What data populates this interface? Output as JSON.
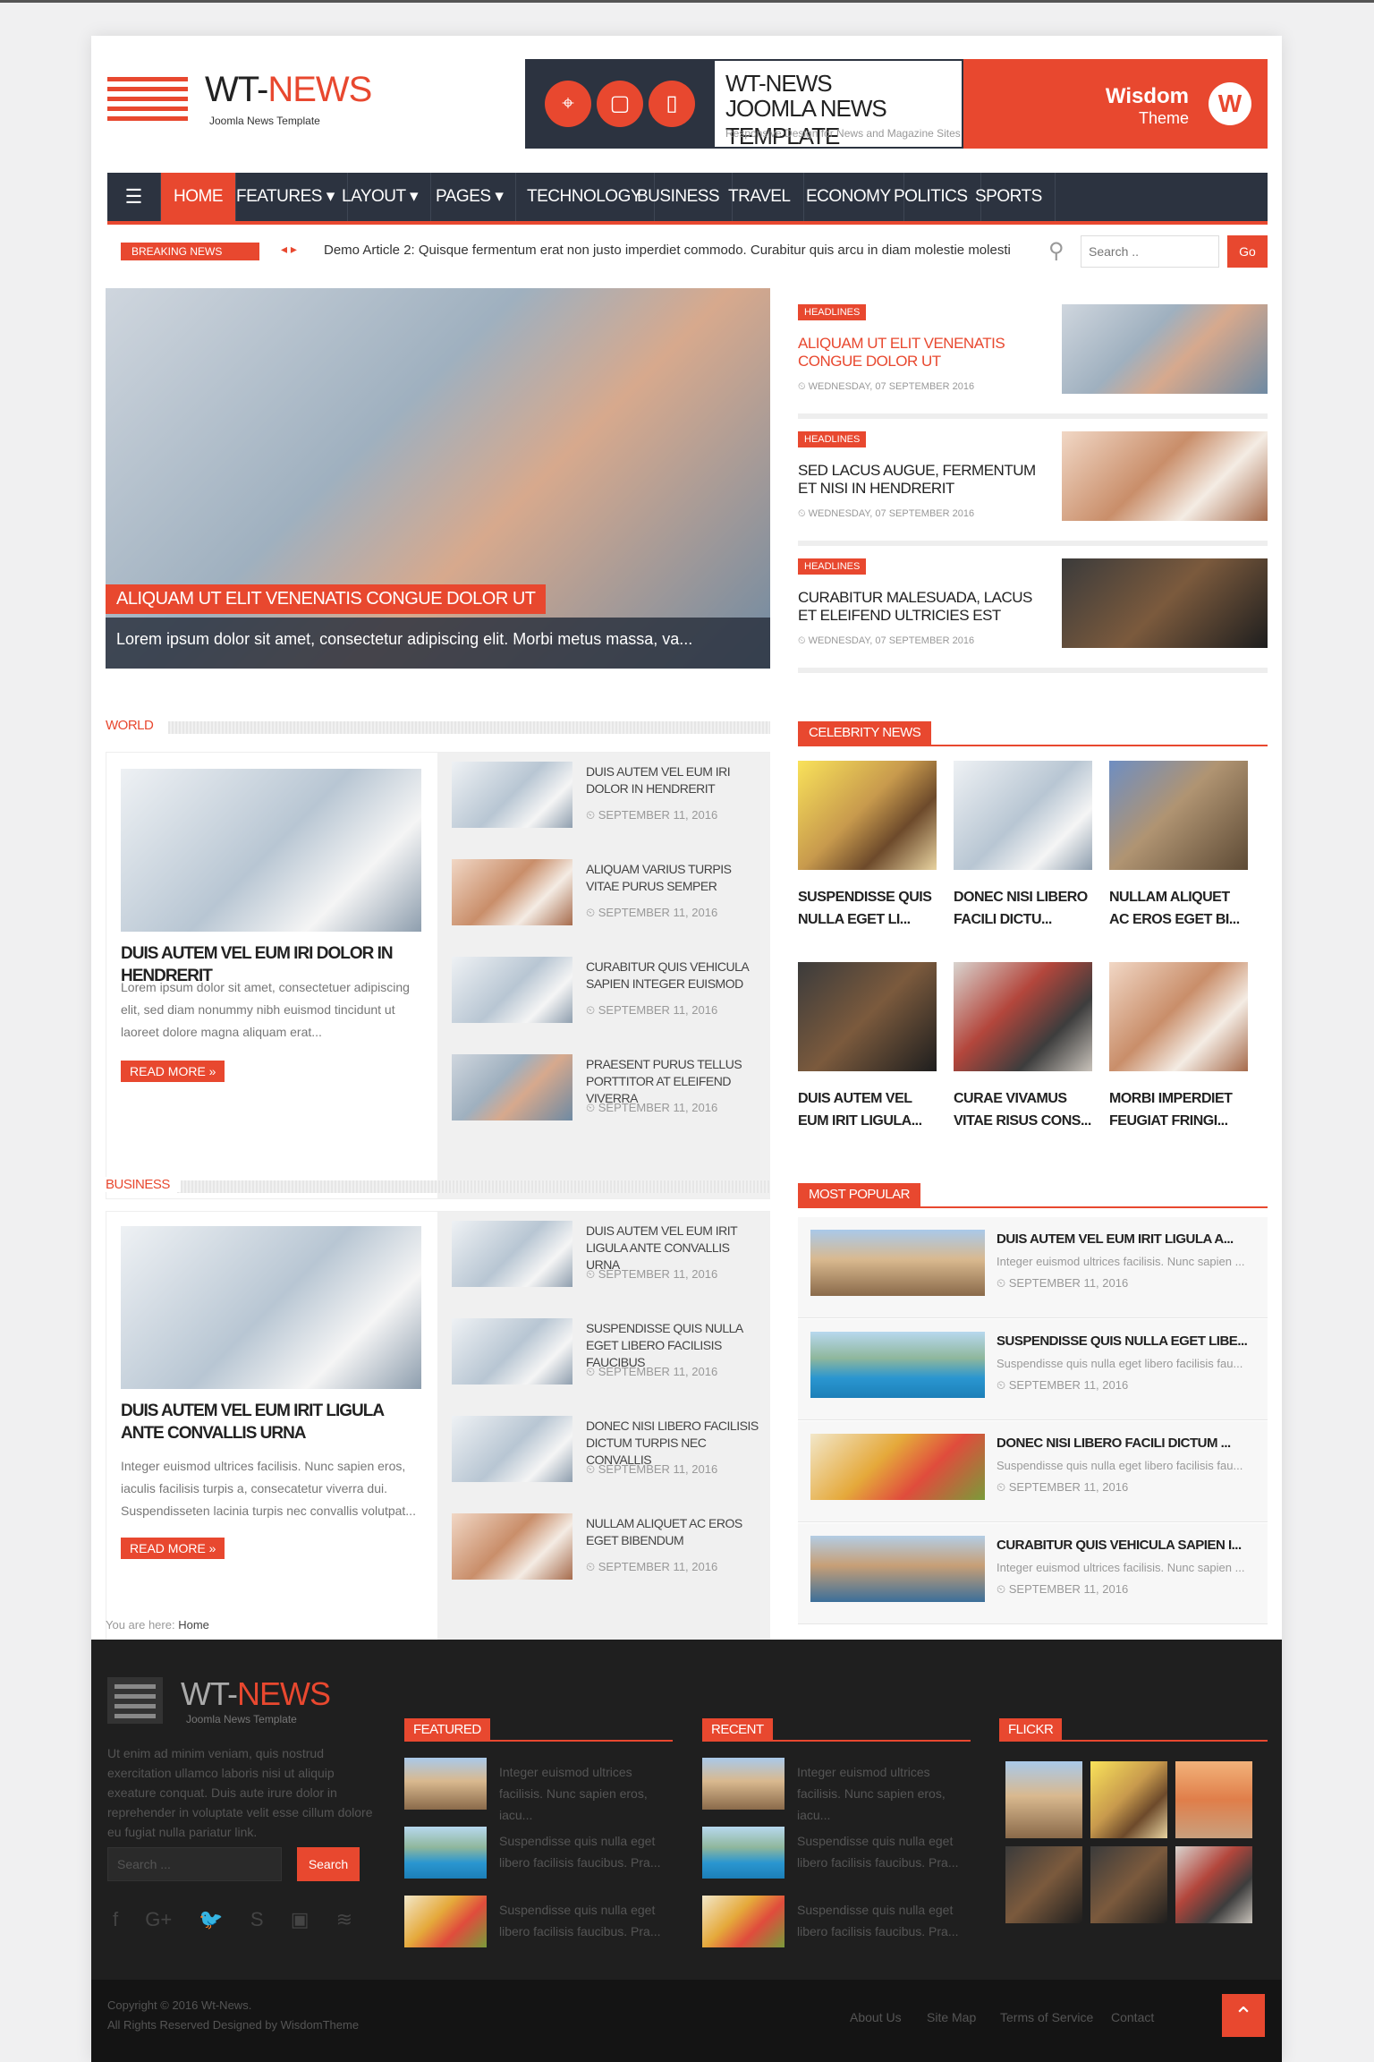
{
  "header": {
    "logo_main": "WT-",
    "logo_accent": "NEWS",
    "logo_sub": "Joomla News Template",
    "banner": {
      "title_line1": "WT-NEWS",
      "title_line2": "JOOMLA NEWS TEMPLATE",
      "subtitle": "Responsive Design for News and Magazine Sites",
      "brand": "Wisdom",
      "brand_sub": "Theme",
      "brand_logo": "W"
    }
  },
  "nav": {
    "menu_icon": "☰",
    "items": [
      "HOME",
      "FEATURES ▾",
      "LAYOUT ▾",
      "PAGES ▾",
      "TECHNOLOGY",
      "BUSINESS",
      "TRAVEL",
      "ECONOMY",
      "POLITICS",
      "SPORTS"
    ]
  },
  "breaking": {
    "label": "BREAKING NEWS",
    "arrows": "◂ ▸",
    "text": "Demo Article 2: Quisque fermentum erat non justo imperdiet commodo. Curabitur quis arcu in diam molestie molesti",
    "search_placeholder": "Search ..",
    "search_button": "Go"
  },
  "hero": {
    "caption": "ALIQUAM UT ELIT VENENATIS CONGUE DOLOR UT",
    "desc": "Lorem ipsum dolor sit amet, consectetur adipiscing elit. Morbi metus massa, va..."
  },
  "headlines": [
    {
      "tag": "HEADLINES",
      "title": "ALIQUAM UT ELIT VENENATIS CONGUE DOLOR UT",
      "date": "WEDNESDAY, 07 SEPTEMBER 2016"
    },
    {
      "tag": "HEADLINES",
      "title": "SED LACUS AUGUE, FERMENTUM ET NISI IN HENDRERIT",
      "date": "WEDNESDAY, 07 SEPTEMBER 2016"
    },
    {
      "tag": "HEADLINES",
      "title": "CURABITUR MALESUADA, LACUS ET ELEIFEND ULTRICIES EST",
      "date": "WEDNESDAY, 07 SEPTEMBER 2016"
    }
  ],
  "world": {
    "label": "WORLD",
    "feature_title": "DUIS AUTEM VEL EUM IRI DOLOR IN HENDRERIT",
    "feature_desc": "Lorem ipsum dolor sit amet, consectetuer adipiscing elit, sed diam nonummy nibh euismod tincidunt ut laoreet dolore magna aliquam erat...",
    "read_more": "READ MORE »",
    "items": [
      {
        "title": "DUIS AUTEM VEL EUM IRI DOLOR IN HENDRERIT",
        "date": "SEPTEMBER 11, 2016"
      },
      {
        "title": "ALIQUAM VARIUS TURPIS VITAE PURUS SEMPER",
        "date": "SEPTEMBER 11, 2016"
      },
      {
        "title": "CURABITUR QUIS VEHICULA SAPIEN INTEGER EUISMOD",
        "date": "SEPTEMBER 11, 2016"
      },
      {
        "title": "PRAESENT PURUS TELLUS PORTTITOR AT ELEIFEND VIVERRA",
        "date": "SEPTEMBER 11, 2016"
      }
    ]
  },
  "business": {
    "label": "BUSINESS",
    "feature_title": "DUIS AUTEM VEL EUM IRIT LIGULA ANTE CONVALLIS URNA",
    "feature_desc": "Integer euismod ultrices facilisis. Nunc sapien eros, iaculis facilisis turpis a, consecatetur viverra dui. Suspendisseten lacinia turpis nec convallis volutpat...",
    "read_more": "READ MORE »",
    "items": [
      {
        "title": "DUIS AUTEM VEL EUM IRIT LIGULA ANTE CONVALLIS URNA",
        "date": "SEPTEMBER 11, 2016"
      },
      {
        "title": "SUSPENDISSE QUIS NULLA EGET LIBERO FACILISIS FAUCIBUS",
        "date": "SEPTEMBER 11, 2016"
      },
      {
        "title": "DONEC NISI LIBERO FACILISIS DICTUM TURPIS NEC CONVALLIS",
        "date": "SEPTEMBER 11, 2016"
      },
      {
        "title": "NULLAM ALIQUET AC EROS EGET BIBENDUM",
        "date": "SEPTEMBER 11, 2016"
      }
    ]
  },
  "celebrity": {
    "label": "CELEBRITY NEWS",
    "items": [
      {
        "name": "SUSPENDISSE QUIS NULLA EGET LI..."
      },
      {
        "name": "DONEC NISI LIBERO FACILI DICTU..."
      },
      {
        "name": "NULLAM ALIQUET AC EROS EGET BI..."
      },
      {
        "name": "DUIS AUTEM VEL EUM IRIT LIGULA..."
      },
      {
        "name": "CURAE VIVAMUS VITAE RISUS CONS..."
      },
      {
        "name": "MORBI IMPERDIET FEUGIAT FRINGI..."
      }
    ]
  },
  "popular": {
    "label": "MOST POPULAR",
    "items": [
      {
        "title": "DUIS AUTEM VEL EUM IRIT LIGULA A...",
        "snippet": "Integer euismod ultrices facilisis. Nunc sapien ...",
        "date": "SEPTEMBER 11, 2016"
      },
      {
        "title": "SUSPENDISSE QUIS NULLA EGET LIBE...",
        "snippet": "Suspendisse quis nulla eget libero facilisis fau...",
        "date": "SEPTEMBER 11, 2016"
      },
      {
        "title": "DONEC NISI LIBERO FACILI DICTUM ...",
        "snippet": "Suspendisse quis nulla eget libero facilisis fau...",
        "date": "SEPTEMBER 11, 2016"
      },
      {
        "title": "CURABITUR QUIS VEHICULA SAPIEN I...",
        "snippet": "Integer euismod ultrices facilisis. Nunc sapien ...",
        "date": "SEPTEMBER 11, 2016"
      }
    ]
  },
  "breadcrumb": {
    "prefix": "You are here:",
    "current": "Home"
  },
  "footer": {
    "logo_main": "WT-",
    "logo_accent": "NEWS",
    "logo_sub": "Joomla News Template",
    "about": "Ut enim ad minim veniam, quis nostrud exercitation ullamco laboris nisi ut aliquip exeature conquat. Duis aute irure dolor in reprehender in voluptate velit esse cillum dolore eu fugiat nulla pariatur link.",
    "search_placeholder": "Search ...",
    "search_button": "Search",
    "social": [
      "f",
      "G+",
      "🐦",
      "S",
      "▣",
      "≋"
    ],
    "featured_label": "FEATURED",
    "recent_label": "RECENT",
    "flickr_label": "FLICKR",
    "featured": [
      {
        "text": "Integer euismod ultrices facilisis. Nunc sapien eros, iacu..."
      },
      {
        "text": "Suspendisse quis nulla eget libero facilisis faucibus. Pra..."
      },
      {
        "text": "Suspendisse quis nulla eget libero facilisis faucibus. Pra..."
      }
    ],
    "recent": [
      {
        "text": "Integer euismod ultrices facilisis. Nunc sapien eros, iacu..."
      },
      {
        "text": "Suspendisse quis nulla eget libero facilisis faucibus. Pra..."
      },
      {
        "text": "Suspendisse quis nulla eget libero facilisis faucibus. Pra..."
      }
    ],
    "copyright_line1": "Copyright © 2016 Wt-News.",
    "copyright_line2": "All Rights Reserved Designed by WisdomTheme",
    "links": [
      "About Us",
      "Site Map",
      "Terms of Service",
      "Contact"
    ],
    "to_top": "⌃"
  },
  "colors": {
    "accent": "#e8482f",
    "dark": "#2c3340",
    "footer": "#1f1f1f"
  }
}
